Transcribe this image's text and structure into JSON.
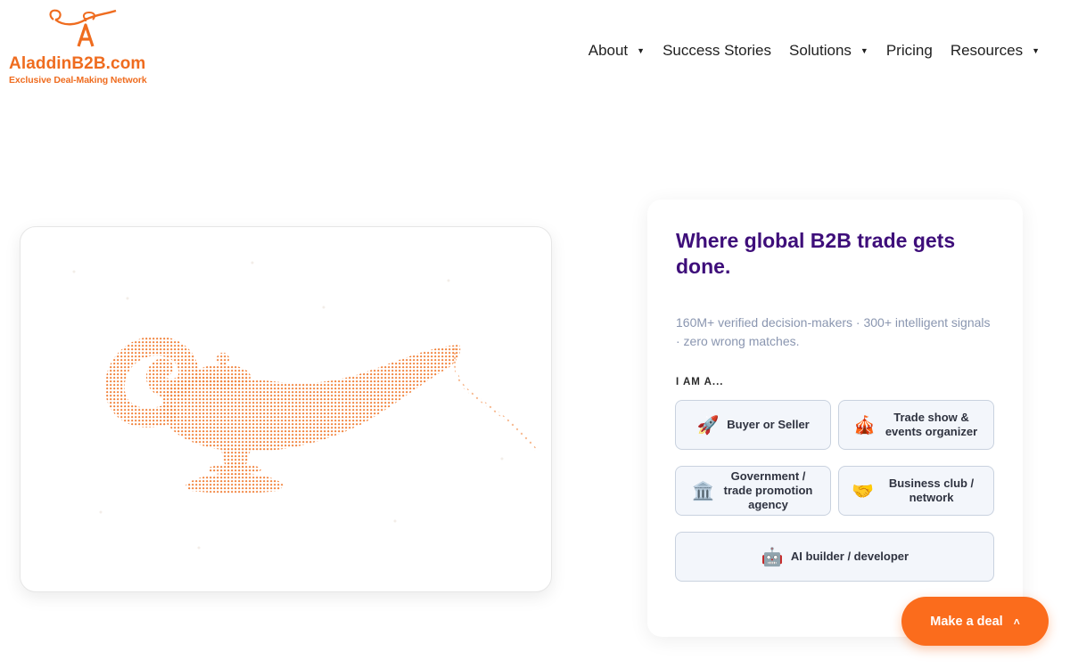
{
  "brand": {
    "name": "AladdinB2B.com",
    "tagline": "Exclusive Deal-Making Network",
    "logo_icon": "genie-lamp-logo-icon",
    "color": "#ef6c1f"
  },
  "nav": {
    "items": [
      {
        "label": "About",
        "has_dropdown": true
      },
      {
        "label": "Success Stories",
        "has_dropdown": false
      },
      {
        "label": "Solutions",
        "has_dropdown": true
      },
      {
        "label": "Pricing",
        "has_dropdown": false
      },
      {
        "label": "Resources",
        "has_dropdown": true
      }
    ],
    "caret": "▼"
  },
  "hero": {
    "image_icon": "magic-lamp-illustration",
    "lamp_color": "#f07a2e"
  },
  "panel": {
    "headline": "Where global B2B trade gets done.",
    "subtitle": "160M+ verified decision-makers · 300+ intelligent signals · zero wrong matches.",
    "role_prompt": "I AM A...",
    "roles": [
      {
        "emoji": "🚀",
        "icon": "rocket-icon",
        "label": "Buyer or Seller"
      },
      {
        "emoji": "🎪",
        "icon": "circus-tent-icon",
        "label": "Trade show & events organizer"
      },
      {
        "emoji": "🏛️",
        "icon": "classical-building-icon",
        "label": "Government / trade promotion agency"
      },
      {
        "emoji": "🤝",
        "icon": "handshake-icon",
        "label": "Business club / network"
      },
      {
        "emoji": "🤖",
        "icon": "robot-icon",
        "label": "AI builder / developer"
      }
    ],
    "headline_color": "#3e0e7a"
  },
  "cta": {
    "label": "Make a deal",
    "chevron": "˄",
    "color": "#fb6c1c"
  }
}
